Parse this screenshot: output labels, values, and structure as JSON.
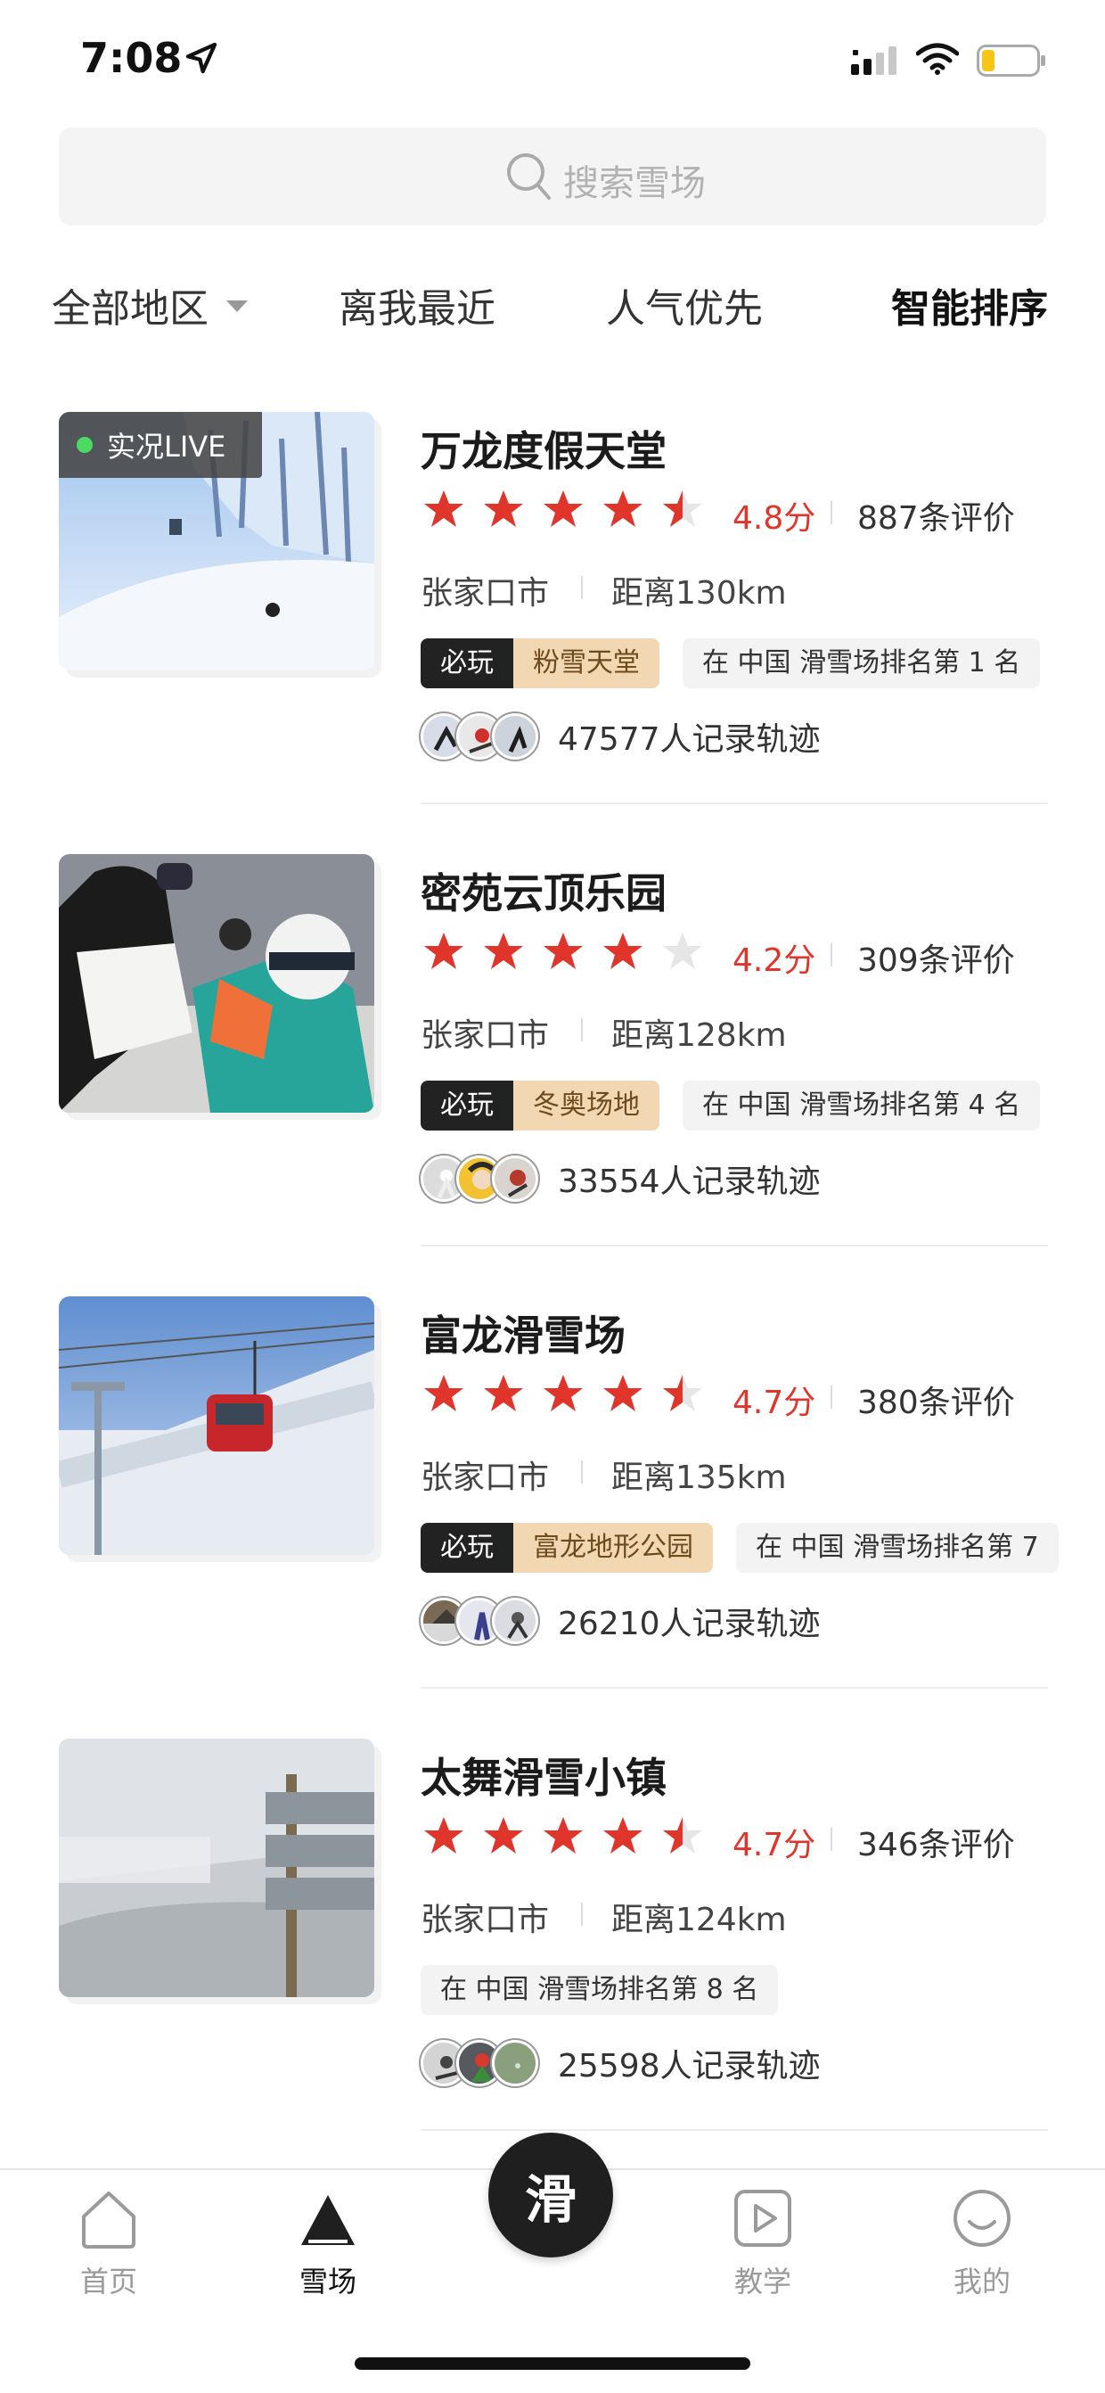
{
  "status_bar": {
    "time": "7:08"
  },
  "search": {
    "placeholder": "搜索雪场"
  },
  "filters": [
    {
      "label": "全部地区",
      "has_dropdown": true,
      "active": false
    },
    {
      "label": "离我最近",
      "active": false
    },
    {
      "label": "人气优先",
      "active": false
    },
    {
      "label": "智能排序",
      "active": true
    }
  ],
  "resorts": [
    {
      "name": "万龙度假天堂",
      "live_label": "实况LIVE",
      "rating": 4.8,
      "score_text": "4.8分",
      "reviews": "887条评价",
      "city": "张家口市",
      "distance": "距离130km",
      "must_label": "必玩",
      "feature_tag": "粉雪天堂",
      "rank_text": "在 中国 滑雪场排名第 1 名",
      "track_text": "47577人记录轨迹"
    },
    {
      "name": "密苑云顶乐园",
      "rating": 4.2,
      "score_text": "4.2分",
      "reviews": "309条评价",
      "city": "张家口市",
      "distance": "距离128km",
      "must_label": "必玩",
      "feature_tag": "冬奥场地",
      "rank_text": "在 中国 滑雪场排名第 4 名",
      "track_text": "33554人记录轨迹"
    },
    {
      "name": "富龙滑雪场",
      "rating": 4.7,
      "score_text": "4.7分",
      "reviews": "380条评价",
      "city": "张家口市",
      "distance": "距离135km",
      "must_label": "必玩",
      "feature_tag": "富龙地形公园",
      "rank_text": "在 中国 滑雪场排名第 7",
      "track_text": "26210人记录轨迹"
    },
    {
      "name": "太舞滑雪小镇",
      "rating": 4.7,
      "score_text": "4.7分",
      "reviews": "346条评价",
      "city": "张家口市",
      "distance": "距离124km",
      "rank_text": "在 中国 滑雪场排名第 8 名",
      "track_text": "25598人记录轨迹"
    }
  ],
  "tab_bar": {
    "items": [
      {
        "label": "首页",
        "icon": "home-icon",
        "active": false
      },
      {
        "label": "雪场",
        "icon": "mountain-icon",
        "active": true
      },
      {
        "label": "教学",
        "icon": "play-icon",
        "active": false
      },
      {
        "label": "我的",
        "icon": "smile-icon",
        "active": false
      }
    ],
    "center_label": "滑"
  },
  "colors": {
    "accent_red": "#e0352b",
    "tag_gold": "#f1d7b2",
    "dark": "#1f1f1f"
  }
}
